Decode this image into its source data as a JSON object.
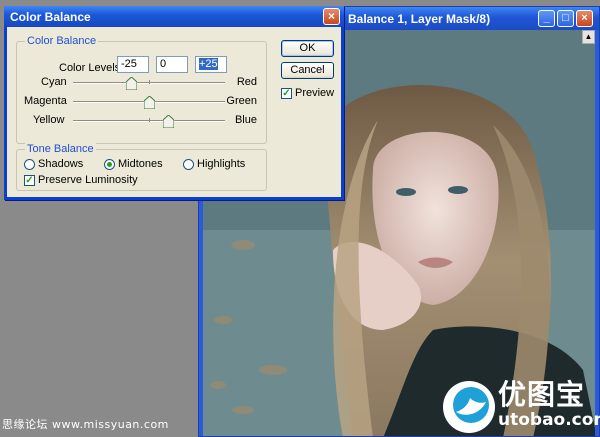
{
  "document": {
    "title": "Balance 1, Layer Mask/8)",
    "buttons": [
      "minimize-icon",
      "maximize-icon",
      "close-icon"
    ]
  },
  "dialog": {
    "title": "Color Balance",
    "color_balance_group": {
      "legend": "Color Balance",
      "levels_label": "Color Levels:",
      "levels": [
        "-25",
        "0",
        "+25"
      ],
      "sliders": [
        {
          "left": "Cyan",
          "right": "Red",
          "value": -25
        },
        {
          "left": "Magenta",
          "right": "Green",
          "value": 0
        },
        {
          "left": "Yellow",
          "right": "Blue",
          "value": 25
        }
      ]
    },
    "tone_balance_group": {
      "legend": "Tone Balance",
      "options": [
        "Shadows",
        "Midtones",
        "Highlights"
      ],
      "selected": "Midtones",
      "preserve_luminosity_label": "Preserve Luminosity",
      "preserve_luminosity_checked": true
    },
    "buttons": {
      "ok": "OK",
      "cancel": "Cancel",
      "preview_label": "Preview",
      "preview_checked": true
    }
  },
  "watermarks": {
    "left": "思缘论坛 www.missyuan.com",
    "right_cn": "优图宝",
    "right_en": "utobao.com"
  },
  "colors": {
    "title_blue": "#1d58d8",
    "dialog_bg": "#ece9d8",
    "legend_blue": "#1f4fd6",
    "close_red": "#c8461e"
  }
}
